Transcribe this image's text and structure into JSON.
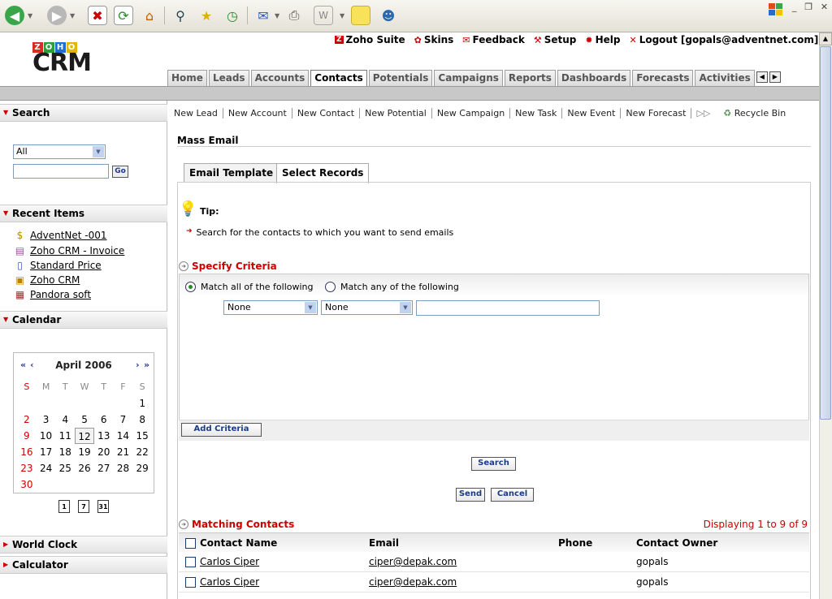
{
  "browser": {
    "buttons": [
      "back-icon",
      "forward-icon",
      "stop-icon",
      "refresh-icon",
      "home-icon",
      "search-icon",
      "favorites-icon",
      "history-icon",
      "mail-icon",
      "print-icon",
      "edit-icon",
      "discuss-icon",
      "messenger-icon"
    ],
    "window_controls": [
      "_",
      "❐",
      "✕"
    ]
  },
  "logo": {
    "zoho_letters": [
      "Z",
      "O",
      "H",
      "O"
    ],
    "zoho_colors": [
      "#d62d20",
      "#2e9e3a",
      "#1f6ed4",
      "#e3b505"
    ],
    "product": "CRM"
  },
  "top_links": [
    {
      "label": "Zoho Suite",
      "icon": "zoho-icon"
    },
    {
      "label": "Skins",
      "icon": "skins-icon"
    },
    {
      "label": "Feedback",
      "icon": "mail-icon"
    },
    {
      "label": "Setup",
      "icon": "setup-icon"
    },
    {
      "label": "Help",
      "icon": "help-icon"
    },
    {
      "label": "Logout [gopals@adventnet.com]",
      "icon": "logout-icon"
    }
  ],
  "main_tabs": [
    {
      "label": "Home",
      "active": false
    },
    {
      "label": "Leads",
      "active": false
    },
    {
      "label": "Accounts",
      "active": false
    },
    {
      "label": "Contacts",
      "active": true
    },
    {
      "label": "Potentials",
      "active": false
    },
    {
      "label": "Campaigns",
      "active": false
    },
    {
      "label": "Reports",
      "active": false
    },
    {
      "label": "Dashboards",
      "active": false
    },
    {
      "label": "Forecasts",
      "active": false
    },
    {
      "label": "Activities",
      "active": false
    }
  ],
  "sidebar": {
    "search": {
      "title": "Search",
      "select_value": "All",
      "input_value": "",
      "go_label": "Go"
    },
    "recent": {
      "title": "Recent Items",
      "items": [
        {
          "label": "AdventNet -001",
          "icon": "money-bag-icon"
        },
        {
          "label": "Zoho CRM - Invoice",
          "icon": "invoice-icon"
        },
        {
          "label": "Standard Price",
          "icon": "book-icon"
        },
        {
          "label": "Zoho CRM",
          "icon": "box-icon"
        },
        {
          "label": "Pandora soft",
          "icon": "account-icon"
        }
      ]
    },
    "calendar": {
      "title": "Calendar",
      "month": "April 2006",
      "prev_year": "«",
      "prev_month": "‹",
      "next_month": "›",
      "next_year": "»",
      "dow": [
        "S",
        "M",
        "T",
        "W",
        "T",
        "F",
        "S"
      ],
      "weeks": [
        [
          "",
          "",
          "",
          "",
          "",
          "",
          "1"
        ],
        [
          "2",
          "3",
          "4",
          "5",
          "6",
          "7",
          "8"
        ],
        [
          "9",
          "10",
          "11",
          "12",
          "13",
          "14",
          "15"
        ],
        [
          "16",
          "17",
          "18",
          "19",
          "20",
          "21",
          "22"
        ],
        [
          "23",
          "24",
          "25",
          "26",
          "27",
          "28",
          "29"
        ],
        [
          "30",
          "",
          "",
          "",
          "",
          "",
          ""
        ]
      ],
      "today": "12",
      "view_buttons": [
        "1",
        "7",
        "31"
      ]
    },
    "world_clock": "World Clock",
    "calculator": "Calculator"
  },
  "quick_links": [
    "New Lead",
    "New Account",
    "New Contact",
    "New Potential",
    "New Campaign",
    "New Task",
    "New Event",
    "New Forecast"
  ],
  "recycle_bin": "Recycle Bin",
  "page": {
    "title": "Mass Email",
    "tabs": [
      "Email Template",
      "Select Records"
    ],
    "tip_label": "Tip:",
    "tip_text": "Search for the contacts to which you want to send emails",
    "specify_criteria": "Specify Criteria",
    "match_all": "Match all of the following",
    "match_any": "Match any of the following",
    "field_select": "None",
    "operator_select": "None",
    "criteria_value": "",
    "add_criteria": "Add Criteria",
    "search_btn": "Search",
    "send_btn": "Send",
    "cancel_btn": "Cancel",
    "matching_title": "Matching Contacts",
    "displaying": "Displaying 1 to 9 of 9",
    "columns": [
      "Contact Name",
      "Email",
      "Phone",
      "Contact Owner"
    ],
    "rows": [
      {
        "name": "Carlos Ciper",
        "email": "ciper@depak.com",
        "phone": "",
        "owner": "gopals"
      },
      {
        "name": "Carlos Ciper",
        "email": "ciper@depak.com",
        "phone": "",
        "owner": "gopals"
      }
    ]
  }
}
